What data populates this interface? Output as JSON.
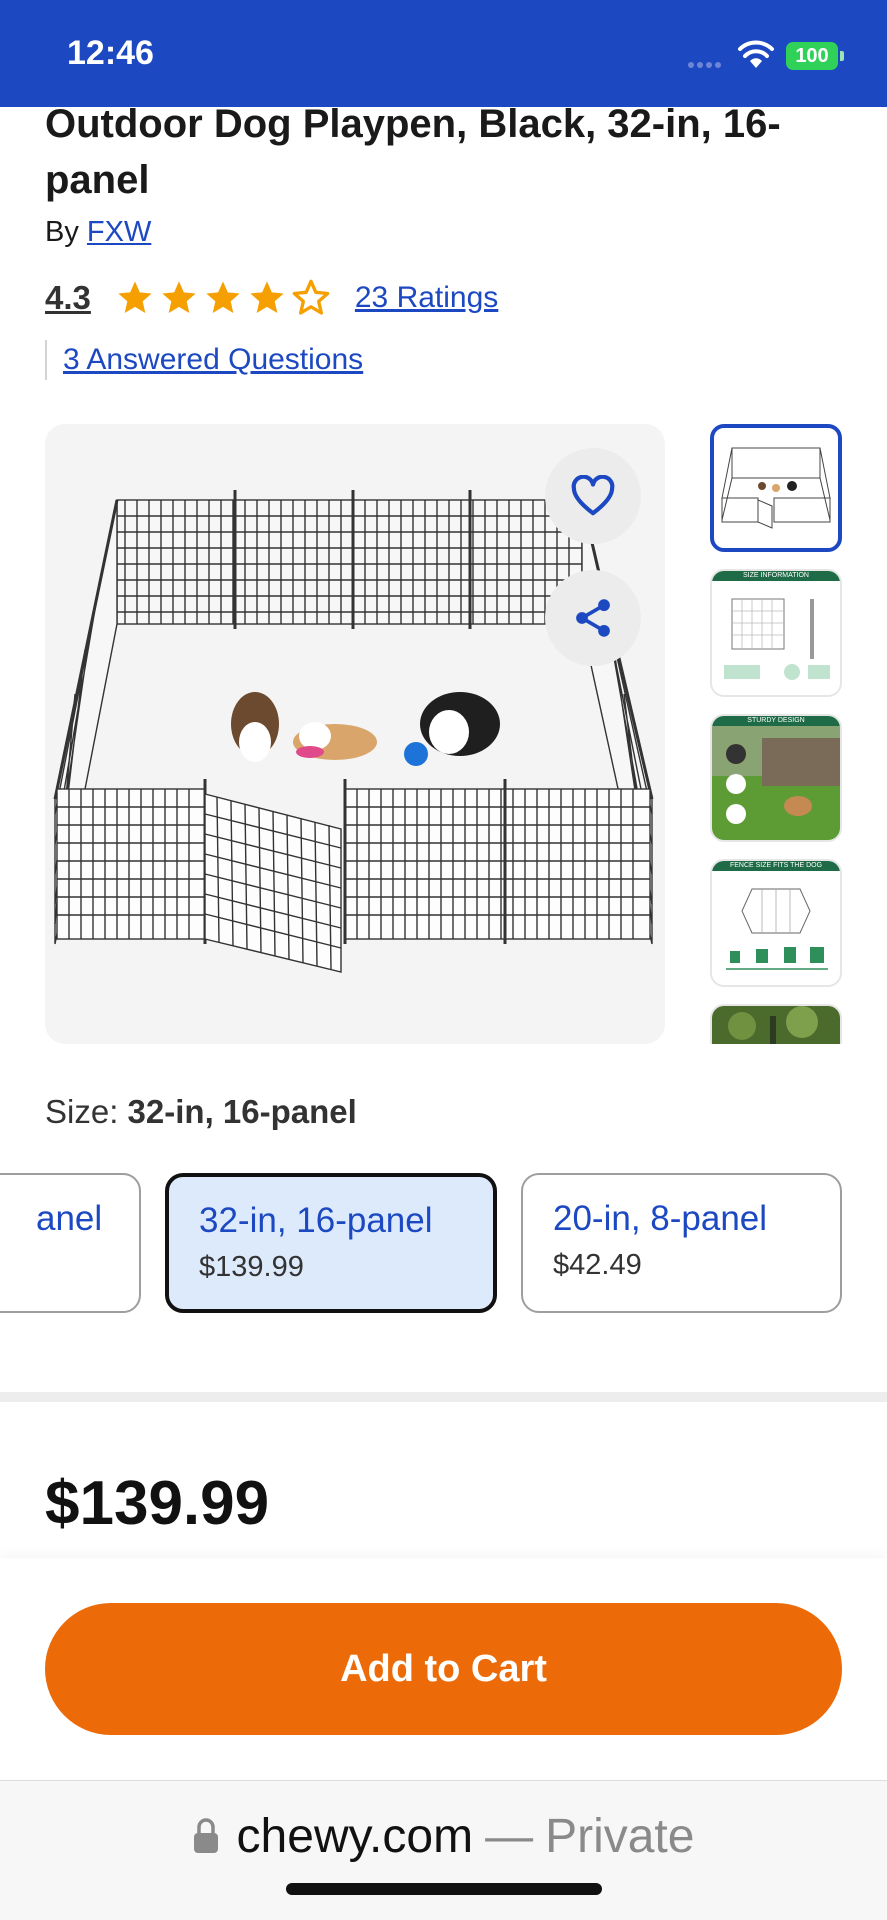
{
  "status_bar": {
    "time": "12:46",
    "battery": "100"
  },
  "product": {
    "title": "Outdoor Dog Playpen, Black, 32-in, 16-panel",
    "by_prefix": "By",
    "brand": "FXW",
    "rating": "4.3",
    "rating_stars": 4.3,
    "ratings_count": "23 Ratings",
    "questions": "3 Answered Questions"
  },
  "gallery": {
    "thumbnails": [
      {
        "active": true
      },
      {
        "caption": "SIZE INFORMATION"
      },
      {
        "caption": "STURDY DESIGN"
      },
      {
        "caption": "FENCE SIZE FITS THE DOG"
      },
      {}
    ]
  },
  "size": {
    "label": "Size:",
    "selected_value": "32-in, 16-panel",
    "options": [
      {
        "name": "anel",
        "price": ""
      },
      {
        "name": "32-in, 16-panel",
        "price": "$139.99"
      },
      {
        "name": "20-in, 8-panel",
        "price": "$42.49"
      }
    ]
  },
  "price": "$139.99",
  "cart": {
    "button_label": "Add to Cart"
  },
  "browser": {
    "domain": "chewy.com",
    "separator": "—",
    "mode": "Private"
  },
  "colors": {
    "brand_blue": "#1c49c2",
    "cta_orange": "#ec6b08",
    "star": "#f5a000",
    "selected_bg": "#ddeafb"
  }
}
